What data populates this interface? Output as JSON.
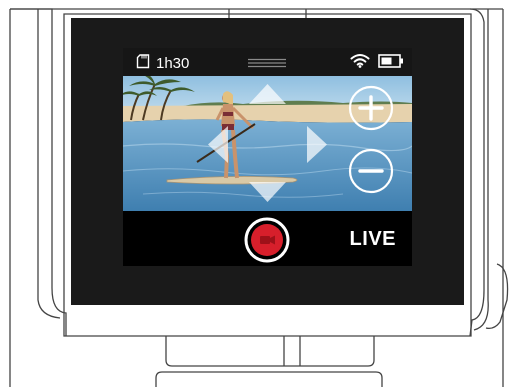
{
  "status": {
    "storage_icon": "sd-card-icon",
    "recording_time_left": "1h30",
    "menu_icon": "menu-handle-icon",
    "wifi_icon": "wifi-icon",
    "battery_icon": "battery-icon"
  },
  "viewfinder": {
    "controls": {
      "up": "arrow-up-icon",
      "down": "arrow-down-icon",
      "left": "arrow-left-icon",
      "right": "arrow-right-icon",
      "zoom_in": "zoom-in-icon",
      "zoom_out": "zoom-out-icon"
    }
  },
  "bottom_bar": {
    "record_icon": "record-video-icon",
    "live_label": "LIVE"
  },
  "colors": {
    "record": "#d71f2b",
    "bezel": "#1a1a1a",
    "status_bar": "#161616",
    "sky": "#9ec7e3",
    "water": "#5b98c5",
    "sand": "#e6d2ad"
  }
}
